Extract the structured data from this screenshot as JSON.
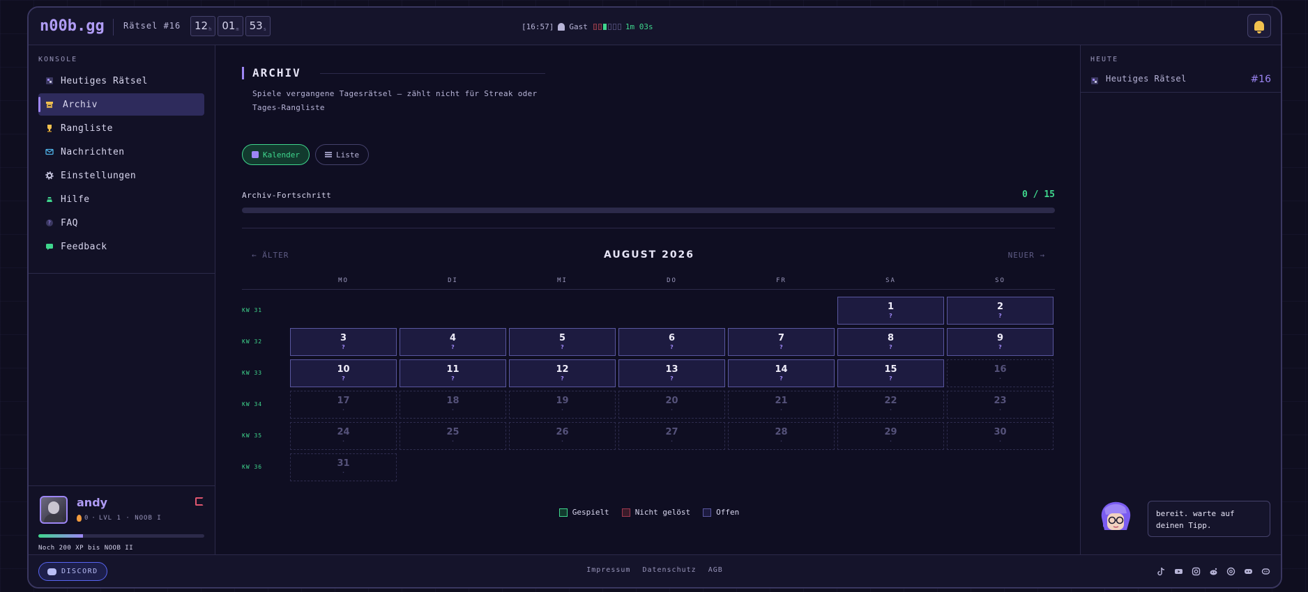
{
  "header": {
    "logo": "n00b.gg",
    "puzzle_label": "Rätsel #16",
    "timer": [
      {
        "value": "12",
        "unit": "h"
      },
      {
        "value": "01",
        "unit": "m"
      },
      {
        "value": "53",
        "unit": "s"
      }
    ],
    "status_time": "[16:57]",
    "status_user": "Gast",
    "status_duration": "1m 03s",
    "bell_icon": "bell-icon"
  },
  "sidebar": {
    "section_title": "KONSOLE",
    "items": [
      {
        "label": "Heutiges Rätsel",
        "icon": "puzzle-icon",
        "color": "#9d86f5"
      },
      {
        "label": "Archiv",
        "icon": "archive-icon",
        "color": "#f2c14e"
      },
      {
        "label": "Rangliste",
        "icon": "trophy-icon",
        "color": "#f2c14e"
      },
      {
        "label": "Nachrichten",
        "icon": "mail-icon",
        "color": "#4fb3e8"
      },
      {
        "label": "Einstellungen",
        "icon": "gear-icon",
        "color": "#c8c6e0"
      },
      {
        "label": "Hilfe",
        "icon": "help-icon",
        "color": "#3fd68d"
      },
      {
        "label": "FAQ",
        "icon": "question-icon",
        "color": "#9d86f5"
      },
      {
        "label": "Feedback",
        "icon": "chat-icon",
        "color": "#3fd68d"
      }
    ],
    "active_index": 1,
    "user": {
      "name": "andy",
      "streak": "0",
      "level": "LVL 1 · NOOB I",
      "xp_progress": 0.27,
      "xp_text": "Noch 200 XP bis NOOB II"
    }
  },
  "main": {
    "title": "ARCHIV",
    "description": "Spiele vergangene Tagesrätsel — zählt nicht für Streak oder Tages-Rangliste",
    "views": [
      {
        "label": "Kalender",
        "active": true
      },
      {
        "label": "Liste",
        "active": false
      }
    ],
    "progress": {
      "label": "Archiv-Fortschritt",
      "value_text": "0 / 15",
      "done": 0,
      "total": 15
    },
    "calendar": {
      "prev": "← ÄLTER",
      "next": "NEUER →",
      "month": "AUGUST 2026",
      "weekdays": [
        "MO",
        "DI",
        "MI",
        "DO",
        "FR",
        "SA",
        "SO"
      ],
      "weeks": [
        "KW 31",
        "KW 32",
        "KW 33",
        "KW 34",
        "KW 35",
        "KW 36"
      ],
      "first_weekday_index": 5,
      "days_in_month": 31,
      "open_until": 15,
      "open_mark": "?",
      "future_mark": "·"
    },
    "legend": [
      {
        "label": "Gespielt",
        "border": "#3fd68d",
        "fill": "#123a2e"
      },
      {
        "label": "Nicht gelöst",
        "border": "#a0394f",
        "fill": "#3a1b2a"
      },
      {
        "label": "Offen",
        "border": "#5a57a0",
        "fill": "#1d1b40"
      }
    ]
  },
  "right": {
    "section_title": "HEUTE",
    "today_label": "Heutiges Rätsel",
    "today_number": "#16",
    "bubble": "bereit. warte auf deinen Tipp."
  },
  "footer": {
    "discord": "DISCORD",
    "links": [
      "Impressum",
      "Datenschutz",
      "AGB"
    ],
    "socials": [
      "tiktok-icon",
      "youtube-icon",
      "instagram-icon",
      "reddit-icon",
      "threads-icon",
      "discord-icon",
      "twitch-icon"
    ]
  },
  "colors": {
    "accent": "#9d86f5",
    "success": "#3fd68d",
    "warning": "#f2c14e",
    "danger": "#e0566f",
    "background": "#0f0e1f"
  }
}
